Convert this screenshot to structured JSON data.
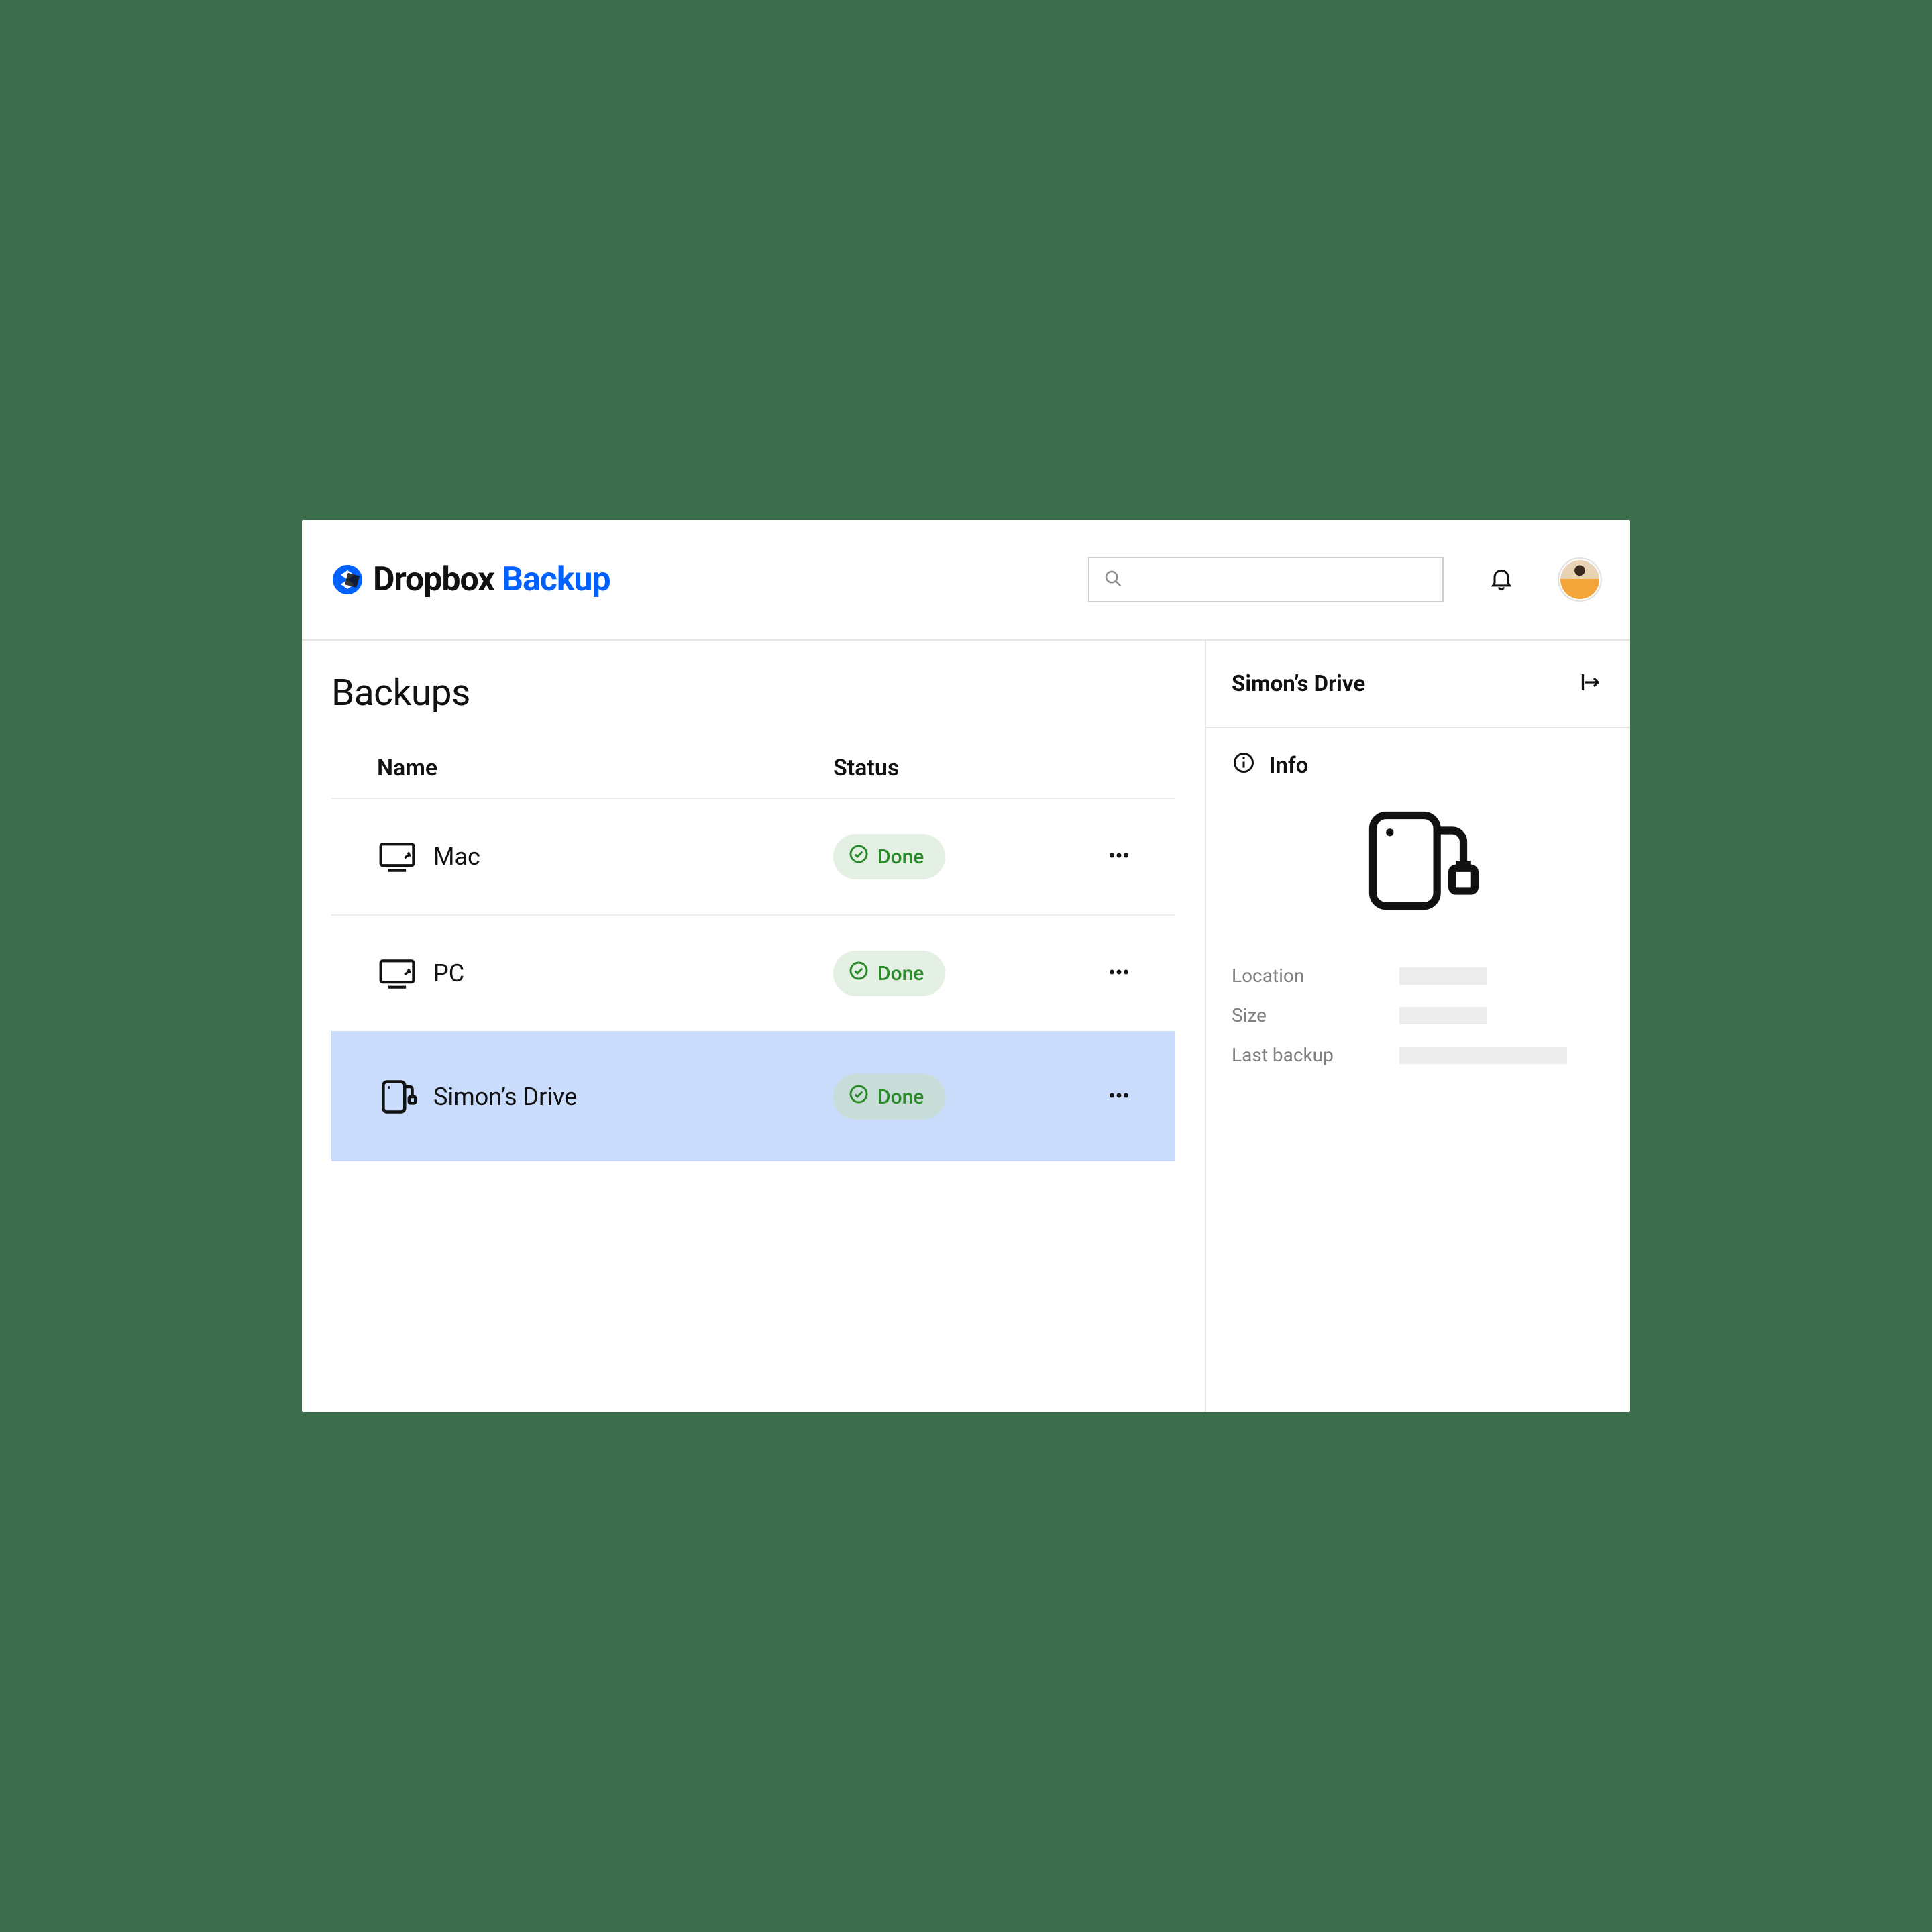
{
  "brand": {
    "text1": "Dropbox ",
    "text2": "Backup"
  },
  "search": {
    "placeholder": ""
  },
  "page": {
    "title": "Backups"
  },
  "table": {
    "headers": {
      "name": "Name",
      "status": "Status"
    },
    "rows": [
      {
        "icon": "desktop-icon",
        "name": "Mac",
        "status": "Done",
        "selected": false
      },
      {
        "icon": "desktop-icon",
        "name": "PC",
        "status": "Done",
        "selected": false
      },
      {
        "icon": "drive-icon",
        "name": "Simon’s Drive",
        "status": "Done",
        "selected": true
      }
    ]
  },
  "panel": {
    "title": "Simon’s Drive",
    "info_label": "Info",
    "fields": {
      "location": "Location",
      "size": "Size",
      "last_backup": "Last backup"
    }
  },
  "icons": {
    "search": "search-icon",
    "bell": "bell-icon",
    "avatar": "avatar",
    "more": "more-icon",
    "collapse": "collapse-panel-icon",
    "info": "info-icon",
    "drive_large": "external-drive-icon"
  },
  "colors": {
    "accent_blue": "#0061fe",
    "status_green": "#2a8a2a",
    "selection": "#c9dcfb",
    "page_bg": "#3b6c4b"
  }
}
